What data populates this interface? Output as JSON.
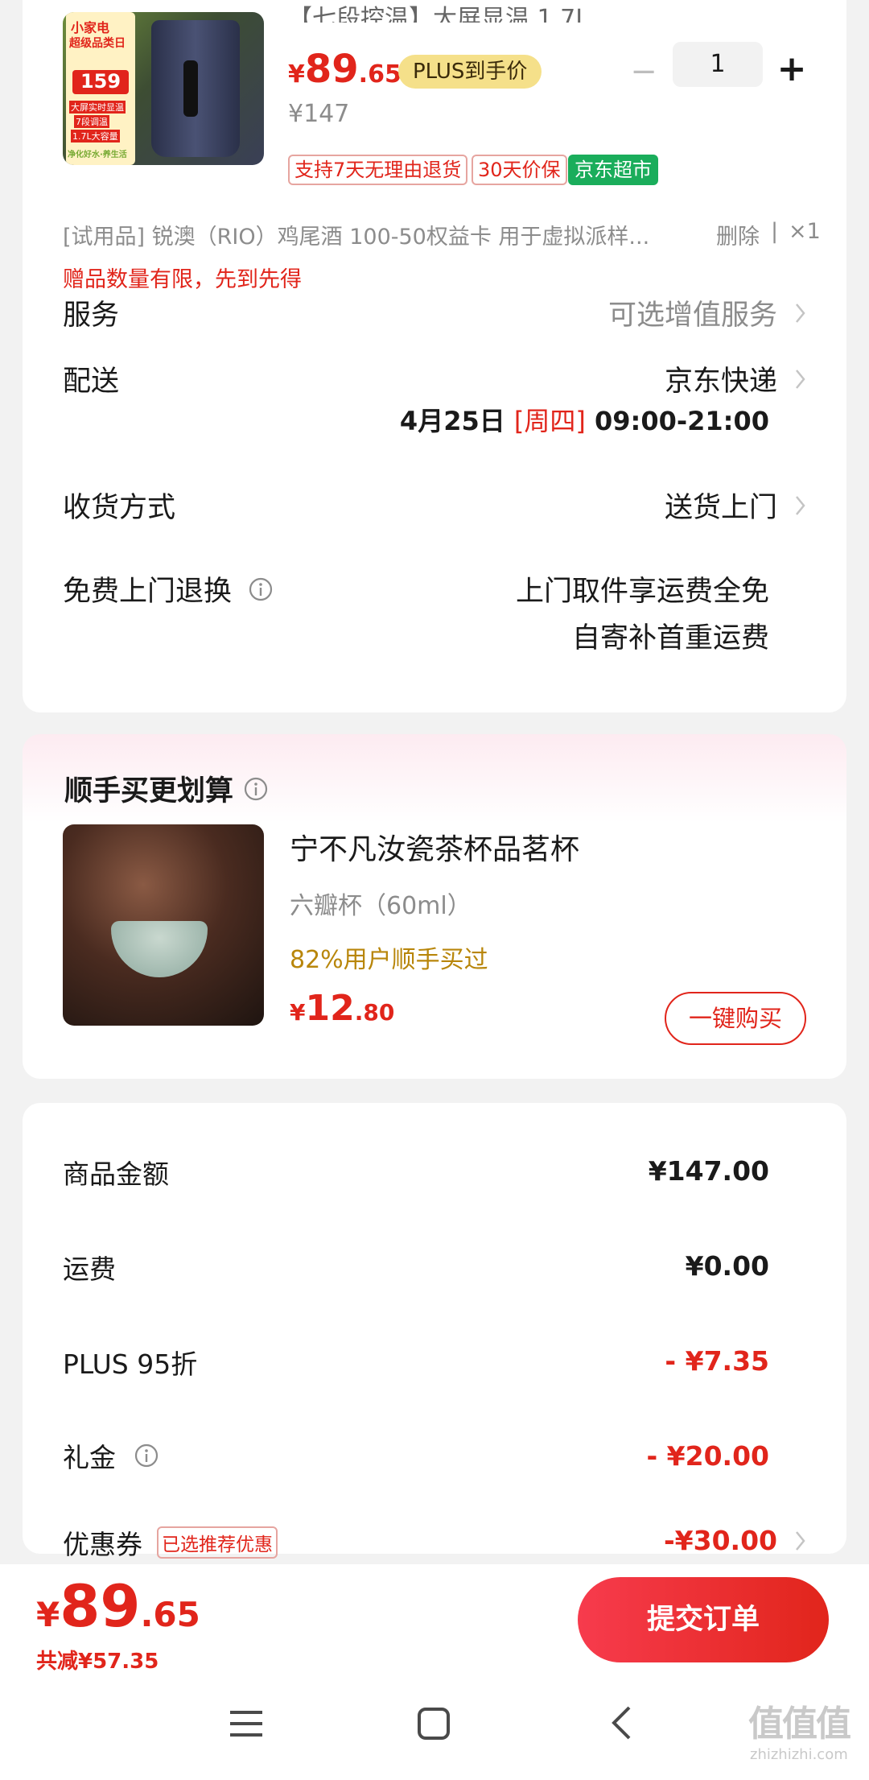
{
  "product": {
    "title_partial": "【七段控温】大屏显温 1.7L",
    "thumb_badge_top": "小家电",
    "thumb_badge_sub": "超级品类日",
    "thumb_price": "159",
    "thumb_line1": "大屏实时显温",
    "thumb_line2": "7段调温",
    "thumb_line3": "1.7L大容量",
    "thumb_line4": "净化好水·养生活",
    "price_symbol": "¥",
    "price_int": "89",
    "price_dec": ".65",
    "plus_badge": "PLUS到手价",
    "original_price": "¥147",
    "quantity": "1",
    "minus": "−",
    "plus": "+",
    "tags": [
      "支持7天无理由退货",
      "30天价保",
      "京东超市"
    ]
  },
  "trial": {
    "text": "[试用品]  锐澳（RIO）鸡尾酒 100-50权益卡 用于虚拟派样...",
    "delete": "删除",
    "sep": "|",
    "count": "×1",
    "gift_notice": "赠品数量有限，先到先得"
  },
  "rows": {
    "service_label": "服务",
    "service_value": "可选增值服务",
    "delivery_label": "配送",
    "delivery_value": "京东快递",
    "delivery_date": "4月25日",
    "delivery_weekday": "[周四]",
    "delivery_time": "09:00-21:00",
    "receive_label": "收货方式",
    "receive_value": "送货上门",
    "return_label": "免费上门退换",
    "return_value1": "上门取件享运费全免",
    "return_value2": "自寄补首重运费"
  },
  "addon": {
    "title": "顺手买更划算",
    "name": "宁不凡汝瓷茶杯品茗杯",
    "spec": "六瓣杯（60ml）",
    "bought": "82%用户顺手买过",
    "price_symbol": "¥",
    "price_int": "12",
    "price_dec": ".80",
    "buy_button": "一键购买"
  },
  "summary": {
    "goods_label": "商品金额",
    "goods_value": "¥147.00",
    "shipping_label": "运费",
    "shipping_value": "¥0.00",
    "plus_label": "PLUS 95折",
    "plus_value": "- ¥7.35",
    "gift_label": "礼金",
    "gift_value": "- ¥20.00",
    "coupon_label": "优惠券",
    "coupon_tag": "已选推荐优惠",
    "coupon_value": "-¥30.00"
  },
  "bottom": {
    "price_symbol": "¥",
    "price_int": "89",
    "price_dec": ".65",
    "saved": "共减¥57.35",
    "submit": "提交订单"
  },
  "watermark": {
    "logo": "值值值",
    "url": "zhizhizhi.com"
  },
  "colors": {
    "accent_red": "#e1251b",
    "plus_gold": "#f5e08a",
    "jd_green": "#1aad5b",
    "gold_text": "#b8860b"
  }
}
